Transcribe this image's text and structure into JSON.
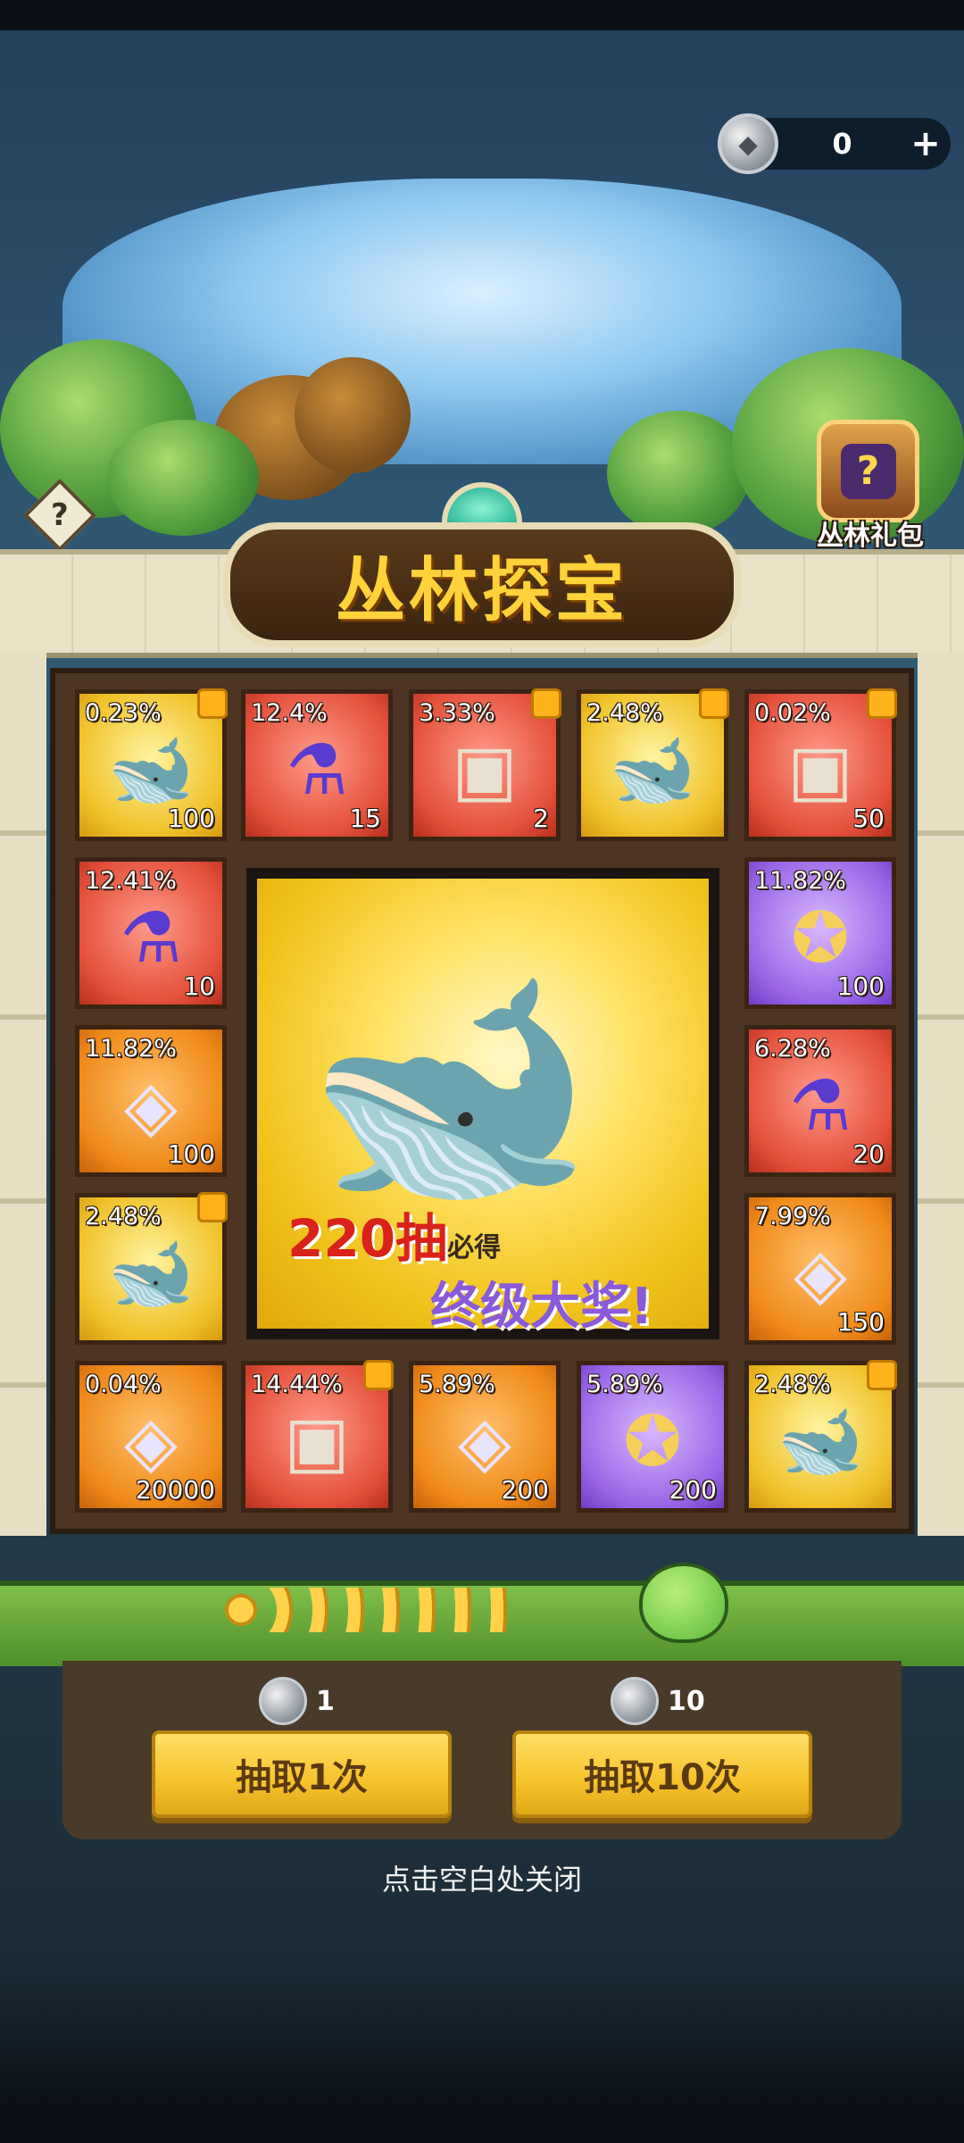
{
  "currency": {
    "amount": "0",
    "plus_icon": "plus-icon"
  },
  "gift_pack": {
    "label": "丛林礼包"
  },
  "help_icon": "?",
  "title": "丛林探宝",
  "grid": [
    {
      "pct": "0.23%",
      "qty": "100",
      "color": "yellow",
      "item": "narwhal",
      "badge": true
    },
    {
      "pct": "12.4%",
      "qty": "15",
      "color": "red",
      "item": "potion",
      "badge": false
    },
    {
      "pct": "3.33%",
      "qty": "2",
      "color": "red",
      "item": "chest",
      "badge": true
    },
    {
      "pct": "2.48%",
      "qty": "",
      "color": "yellow",
      "item": "narwhal",
      "badge": true
    },
    {
      "pct": "0.02%",
      "qty": "50",
      "color": "red",
      "item": "chest",
      "badge": true
    },
    {
      "pct": "12.41%",
      "qty": "10",
      "color": "red",
      "item": "potion",
      "badge": false
    },
    {
      "pct": "11.82%",
      "qty": "100",
      "color": "purple",
      "item": "medal",
      "badge": false
    },
    {
      "pct": "11.82%",
      "qty": "100",
      "color": "orange",
      "item": "gem",
      "badge": false
    },
    {
      "pct": "6.28%",
      "qty": "20",
      "color": "red",
      "item": "potion",
      "badge": false
    },
    {
      "pct": "2.48%",
      "qty": "",
      "color": "yellow",
      "item": "narwhal",
      "badge": true
    },
    {
      "pct": "7.99%",
      "qty": "150",
      "color": "orange",
      "item": "gem",
      "badge": false
    },
    {
      "pct": "0.04%",
      "qty": "20000",
      "color": "orange",
      "item": "gem",
      "badge": false
    },
    {
      "pct": "14.44%",
      "qty": "",
      "color": "red",
      "item": "chest",
      "badge": true
    },
    {
      "pct": "5.89%",
      "qty": "200",
      "color": "orange",
      "item": "gem",
      "badge": false
    },
    {
      "pct": "5.89%",
      "qty": "200",
      "color": "purple",
      "item": "medal",
      "badge": false
    },
    {
      "pct": "2.48%",
      "qty": "",
      "color": "yellow",
      "item": "narwhal",
      "badge": true
    }
  ],
  "jackpot": {
    "count": "220抽",
    "suffix": "必得",
    "prize": "终级大奖!"
  },
  "draw_one": {
    "cost": "1",
    "label": "抽取1次"
  },
  "draw_ten": {
    "cost": "10",
    "label": "抽取10次"
  },
  "close_hint": "点击空白处关闭"
}
